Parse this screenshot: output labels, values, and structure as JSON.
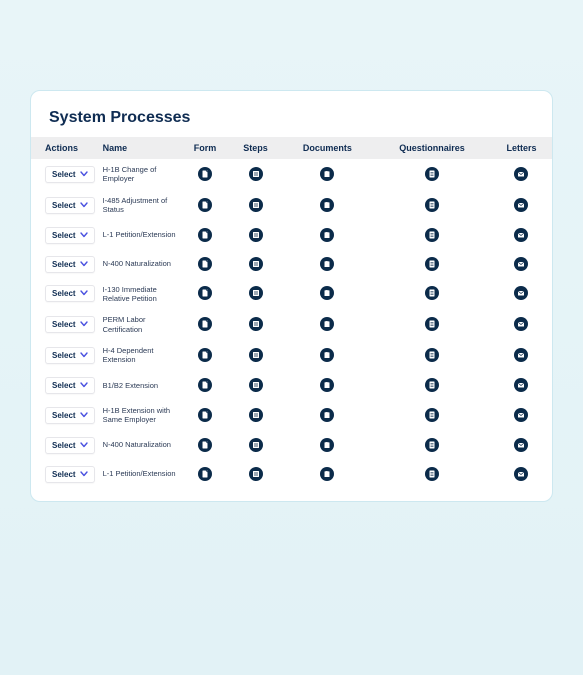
{
  "title": "System Processes",
  "actions_label": "Select",
  "columns": [
    "Actions",
    "Name",
    "Form",
    "Steps",
    "Documents",
    "Questionnaires",
    "Letters"
  ],
  "rows": [
    {
      "name": "H-1B Change of Employer"
    },
    {
      "name": "I-485 Adjustment of Status"
    },
    {
      "name": "L-1 Petition/Extension"
    },
    {
      "name": "N-400 Naturalization"
    },
    {
      "name": "I-130 Immediate Relative Petition"
    },
    {
      "name": "PERM Labor Certification"
    },
    {
      "name": "H-4 Dependent Extension"
    },
    {
      "name": "B1/B2 Extension"
    },
    {
      "name": "H-1B Extension with Same Employer"
    },
    {
      "name": "N-400 Naturalization"
    },
    {
      "name": "L-1 Petition/Extension"
    }
  ],
  "icons": {
    "form": "form-icon",
    "steps": "steps-icon",
    "documents": "documents-icon",
    "questionnaires": "questionnaires-icon",
    "letters": "letters-icon"
  },
  "colors": {
    "icon_bg": "#0b2b4a",
    "icon_fg": "#ffffff",
    "accent": "#4b52e0"
  }
}
